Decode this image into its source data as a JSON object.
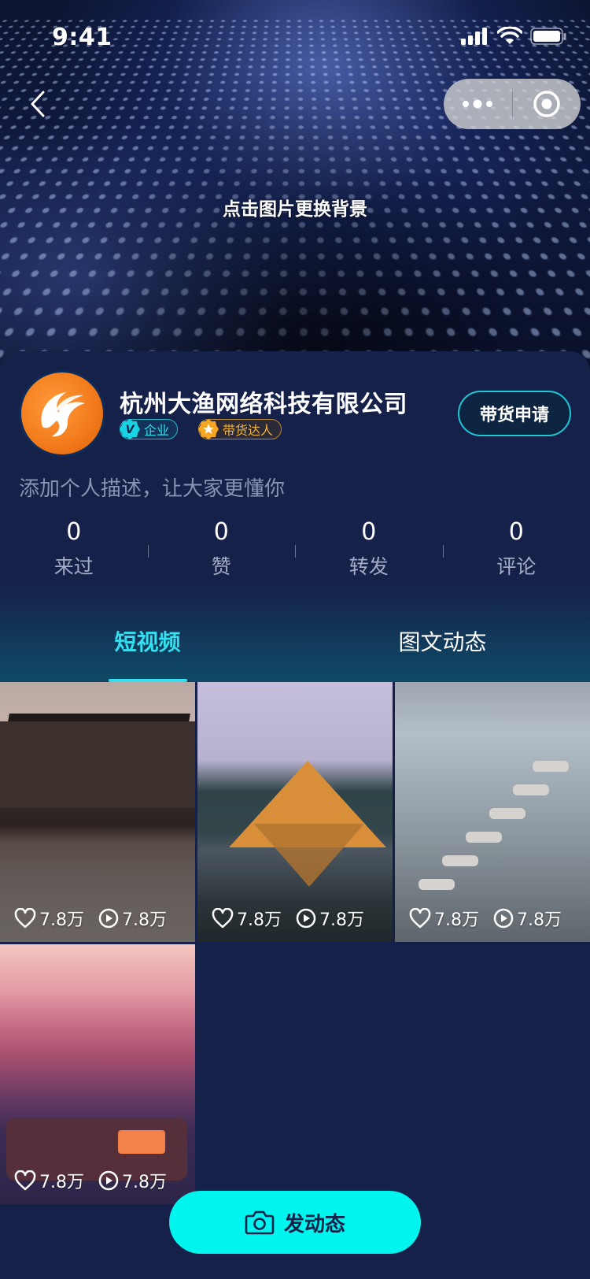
{
  "status_bar": {
    "time": "9:41"
  },
  "header": {
    "change_bg_hint": "点击图片更换背景"
  },
  "profile": {
    "company_name": "杭州大渔网络科技有限公司",
    "badge_enterprise": "企业",
    "badge_seller": "带货达人",
    "apply_button": "带货申请",
    "description_placeholder": "添加个人描述，让大家更懂你",
    "stats": [
      {
        "value": "0",
        "label": "来过"
      },
      {
        "value": "0",
        "label": "赞"
      },
      {
        "value": "0",
        "label": "转发"
      },
      {
        "value": "0",
        "label": "评论"
      }
    ]
  },
  "tabs": [
    {
      "label": "短视频",
      "active": true
    },
    {
      "label": "图文动态",
      "active": false
    }
  ],
  "videos": [
    {
      "likes": "7.8万",
      "plays": "7.8万"
    },
    {
      "likes": "7.8万",
      "plays": "7.8万"
    },
    {
      "likes": "7.8万",
      "plays": "7.8万"
    },
    {
      "likes": "7.8万",
      "plays": "7.8万"
    }
  ],
  "post_button": {
    "label": "发动态"
  },
  "colors": {
    "accent": "#35dff0",
    "background": "#16214a",
    "post_button": "#00f5ef"
  }
}
